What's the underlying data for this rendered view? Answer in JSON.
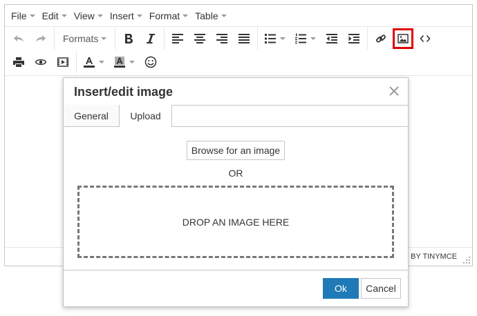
{
  "menubar": {
    "items": [
      {
        "label": "File"
      },
      {
        "label": "Edit"
      },
      {
        "label": "View"
      },
      {
        "label": "Insert"
      },
      {
        "label": "Format"
      },
      {
        "label": "Table"
      }
    ]
  },
  "toolbar": {
    "formats_label": "Formats"
  },
  "statusbar": {
    "powered_by": "POWERED BY TINYMCE"
  },
  "dialog": {
    "title": "Insert/edit image",
    "tabs": [
      {
        "label": "General"
      },
      {
        "label": "Upload"
      }
    ],
    "active_tab": "Upload",
    "browse_label": "Browse for an image",
    "or_label": "OR",
    "dropzone_label": "DROP AN IMAGE HERE",
    "ok_label": "Ok",
    "cancel_label": "Cancel"
  },
  "colors": {
    "highlight": "#e00000",
    "primary": "#207ab7",
    "border": "#c5c5c5"
  },
  "icons": [
    "undo-icon",
    "redo-icon",
    "bold-icon",
    "italic-icon",
    "align-left-icon",
    "align-center-icon",
    "align-right-icon",
    "align-justify-icon",
    "bullet-list-icon",
    "numbered-list-icon",
    "outdent-icon",
    "indent-icon",
    "link-icon",
    "image-icon",
    "code-icon",
    "print-icon",
    "preview-icon",
    "media-icon",
    "text-color-icon",
    "background-color-icon",
    "emoticons-icon",
    "close-icon",
    "resize-handle-icon"
  ]
}
